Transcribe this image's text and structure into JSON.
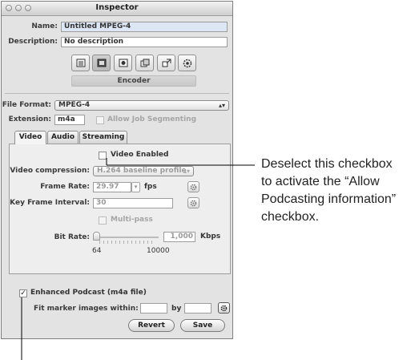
{
  "window": {
    "title": "Inspector"
  },
  "fields": {
    "name_label": "Name:",
    "name_value": "Untitled MPEG-4",
    "description_label": "Description:",
    "description_value": "No description"
  },
  "toolbar": {
    "icons": [
      "summary-icon",
      "encoder-icon",
      "frame-controls-icon",
      "filters-icon",
      "geometry-icon",
      "actions-icon"
    ],
    "selected_pane_label": "Encoder"
  },
  "encoder": {
    "file_format_label": "File Format:",
    "file_format_value": "MPEG-4",
    "extension_label": "Extension:",
    "extension_value": "m4a",
    "allow_job_segmenting_label": "Allow Job Segmenting"
  },
  "tabs": [
    {
      "label": "Video",
      "active": true
    },
    {
      "label": "Audio",
      "active": false
    },
    {
      "label": "Streaming",
      "active": false
    }
  ],
  "video": {
    "video_enabled_label": "Video Enabled",
    "video_compression_label": "Video compression:",
    "video_compression_value": "H.264 baseline profile",
    "frame_rate_label": "Frame Rate:",
    "frame_rate_value": "29.97",
    "frame_rate_unit": "fps",
    "key_frame_interval_label": "Key Frame Interval:",
    "key_frame_interval_value": "30",
    "multipass_label": "Multi-pass",
    "bit_rate_label": "Bit Rate:",
    "bit_rate_value": "1,000",
    "bit_rate_unit": "Kbps",
    "bit_rate_min": "64",
    "bit_rate_max": "10000"
  },
  "podcast": {
    "enhanced_podcast_label": "Enhanced Podcast (m4a file)",
    "enhanced_podcast_checked": true,
    "fit_marker_label": "Fit marker images within:",
    "by_label": "by"
  },
  "buttons": {
    "revert": "Revert",
    "save": "Save"
  },
  "callout": {
    "line1": "Deselect this checkbox",
    "line2": "to activate the “Allow",
    "line3": "Podcasting information”",
    "line4": "checkbox."
  },
  "colors": {
    "window_bg": "#e3e3e3",
    "name_field_highlight": "#dce6f4",
    "annotation_line": "#000000"
  }
}
